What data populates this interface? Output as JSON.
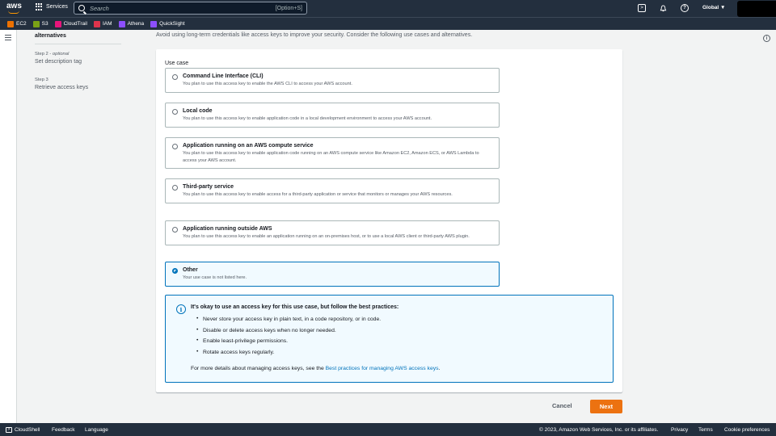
{
  "topnav": {
    "logo": "aws",
    "services_label": "Services",
    "search_placeholder": "Search",
    "search_shortcut": "[Option+S]",
    "region": "Global ▼"
  },
  "favorites": [
    {
      "label": "EC2",
      "color": "#ed7100"
    },
    {
      "label": "S3",
      "color": "#7aa116"
    },
    {
      "label": "CloudTrail",
      "color": "#e7157b"
    },
    {
      "label": "IAM",
      "color": "#dd344c"
    },
    {
      "label": "Athena",
      "color": "#8c4fff"
    },
    {
      "label": "QuickSight",
      "color": "#8c4fff"
    }
  ],
  "steps": {
    "current_tail": "alternatives",
    "step2_label": "Step 2 - ",
    "step2_optional": "optional",
    "step2_name": "Set description tag",
    "step3_label": "Step 3",
    "step3_name": "Retrieve access keys"
  },
  "intro": "Avoid using long-term credentials like access keys to improve your security. Consider the following use cases and alternatives.",
  "use_case_label": "Use case",
  "options": [
    {
      "title": "Command Line Interface (CLI)",
      "desc": "You plan to use this access key to enable the AWS CLI to access your AWS account.",
      "selected": false
    },
    {
      "title": "Local code",
      "desc": "You plan to use this access key to enable application code in a local development environment to access your AWS account.",
      "selected": false
    },
    {
      "title": "Application running on an AWS compute service",
      "desc": "You plan to use this access key to enable application code running on an AWS compute service like Amazon EC2, Amazon ECS, or AWS Lambda to access your AWS account.",
      "selected": false
    },
    {
      "title": "Third-party service",
      "desc": "You plan to use this access key to enable access for a third-party application or service that monitors or manages your AWS resources.",
      "selected": false
    },
    {
      "title": "Application running outside AWS",
      "desc": "You plan to use this access key to enable an application running on an on-premises host, or to use a local AWS client or third-party AWS plugin.",
      "selected": false
    },
    {
      "title": "Other",
      "desc": "Your use case is not listed here.",
      "selected": true
    }
  ],
  "alert": {
    "heading": "It's okay to use an access key for this use case, but follow the best practices:",
    "items": [
      "Never store your access key in plain text, in a code repository, or in code.",
      "Disable or delete access keys when no longer needed.",
      "Enable least-privilege permissions.",
      "Rotate access keys regularly."
    ],
    "more_prefix": "For more details about managing access keys, see the ",
    "more_link": "Best practices for managing AWS access keys",
    "more_suffix": "."
  },
  "actions": {
    "cancel": "Cancel",
    "next": "Next"
  },
  "footer": {
    "cloudshell": "CloudShell",
    "feedback": "Feedback",
    "language": "Language",
    "copyright": "© 2023, Amazon Web Services, Inc. or its affiliates.",
    "privacy": "Privacy",
    "terms": "Terms",
    "cookie": "Cookie preferences"
  }
}
